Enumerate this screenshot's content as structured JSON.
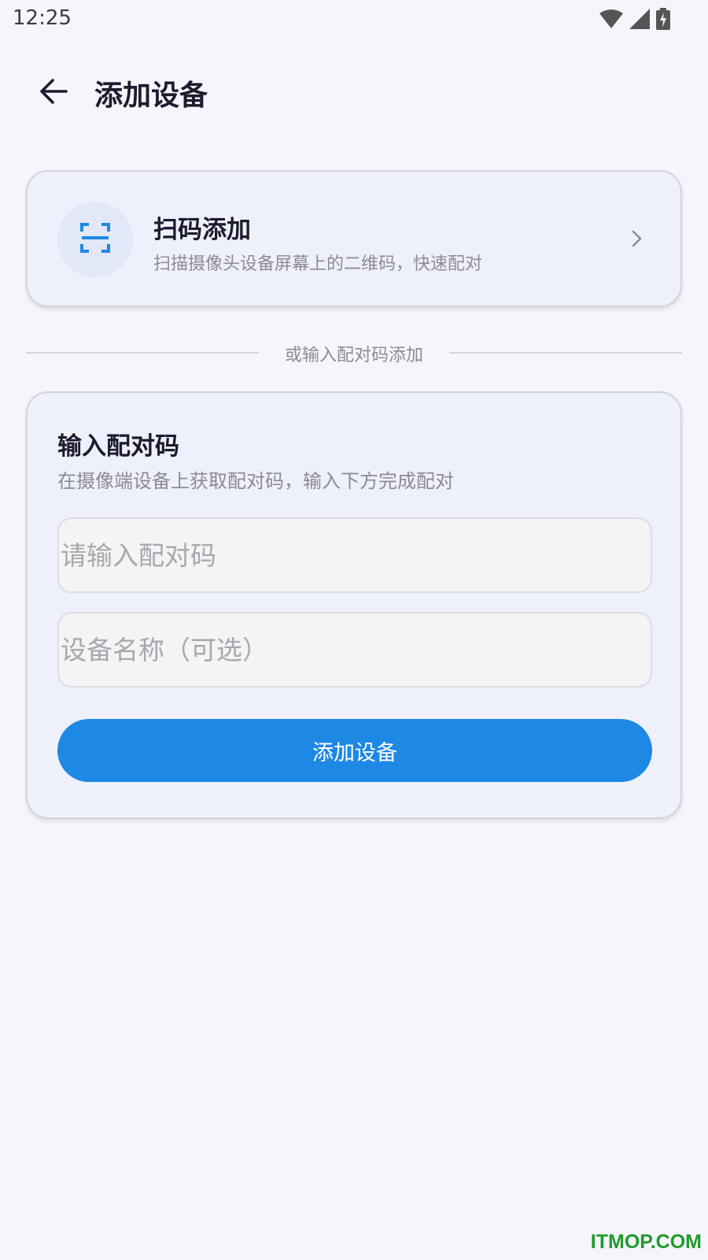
{
  "status_bar": {
    "time": "12:25",
    "icons": [
      "wifi-icon",
      "signal-icon",
      "battery-charging-icon"
    ]
  },
  "app_bar": {
    "back_icon": "arrow-left-icon",
    "title": "添加设备"
  },
  "scan_card": {
    "icon": "qr-scan-icon",
    "title": "扫码添加",
    "subtitle": "扫描摄像头设备屏幕上的二维码，快速配对",
    "chevron_icon": "chevron-right-icon"
  },
  "divider": {
    "text": "或输入配对码添加"
  },
  "pair_card": {
    "title": "输入配对码",
    "subtitle": "在摄像端设备上获取配对码，输入下方完成配对",
    "code_input": {
      "value": "",
      "placeholder": "请输入配对码"
    },
    "name_input": {
      "value": "",
      "placeholder": "设备名称（可选）"
    },
    "submit_label": "添加设备"
  },
  "watermark": "ITMOP.COM",
  "colors": {
    "background": "#f5f6fb",
    "card": "#eef0fc",
    "accent": "#1e88e5",
    "title_text": "#1c1c2e",
    "secondary_text": "#8b8b95",
    "watermark": "#1f9b2a"
  }
}
